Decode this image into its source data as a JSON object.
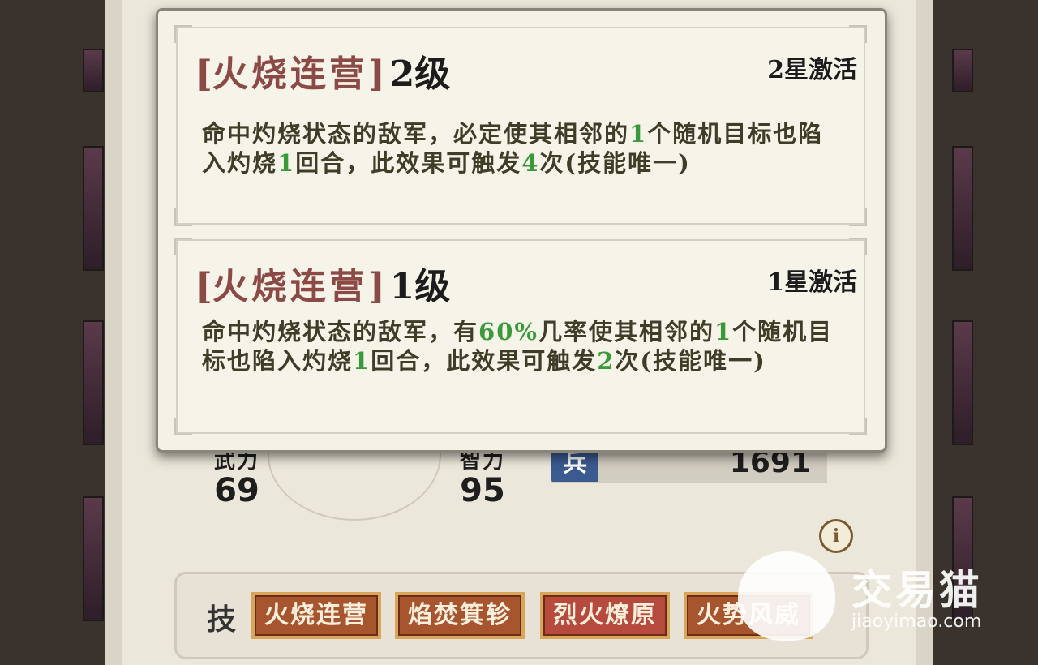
{
  "stats": [
    {
      "label": "武力",
      "value": "69"
    },
    {
      "label": "智力",
      "value": "95"
    }
  ],
  "troops": {
    "icon_label": "兵",
    "value": "1691"
  },
  "info_button": {
    "label": "i"
  },
  "skills": {
    "label": "技",
    "items": [
      "火烧连营",
      "焰焚箕轸",
      "烈火燎原",
      "火势风威"
    ],
    "active_index": 2
  },
  "popup": {
    "cards": [
      {
        "name": "火烧连营",
        "level": "2级",
        "star": "2星激活",
        "desc_parts": [
          {
            "t": "命中灼烧状态的敌军，必定使其相邻的"
          },
          {
            "t": "1",
            "g": true
          },
          {
            "t": "个随机目标也陷入灼烧"
          },
          {
            "t": "1",
            "g": true
          },
          {
            "t": "回合，此效果可触发"
          },
          {
            "t": "4",
            "g": true
          },
          {
            "t": "次(技能唯一)"
          }
        ]
      },
      {
        "name": "火烧连营",
        "level": "1级",
        "star": "1星激活",
        "desc_parts": [
          {
            "t": "命中灼烧状态的敌军，有"
          },
          {
            "t": "60%",
            "g": true
          },
          {
            "t": "几率使其相邻的"
          },
          {
            "t": "1",
            "g": true
          },
          {
            "t": "个随机目标也陷入灼烧"
          },
          {
            "t": "1",
            "g": true
          },
          {
            "t": "回合，此效果可触发"
          },
          {
            "t": "2",
            "g": true
          },
          {
            "t": "次(技能唯一)"
          }
        ]
      }
    ]
  },
  "watermark": {
    "brand": "交易猫",
    "url": "jiaoyimao.com"
  },
  "colors": {
    "highlight": "#3a9a3a",
    "skill_name": "#8b4a45",
    "skill_button": "#a6552e",
    "skill_button_active": "#b74a3e"
  }
}
